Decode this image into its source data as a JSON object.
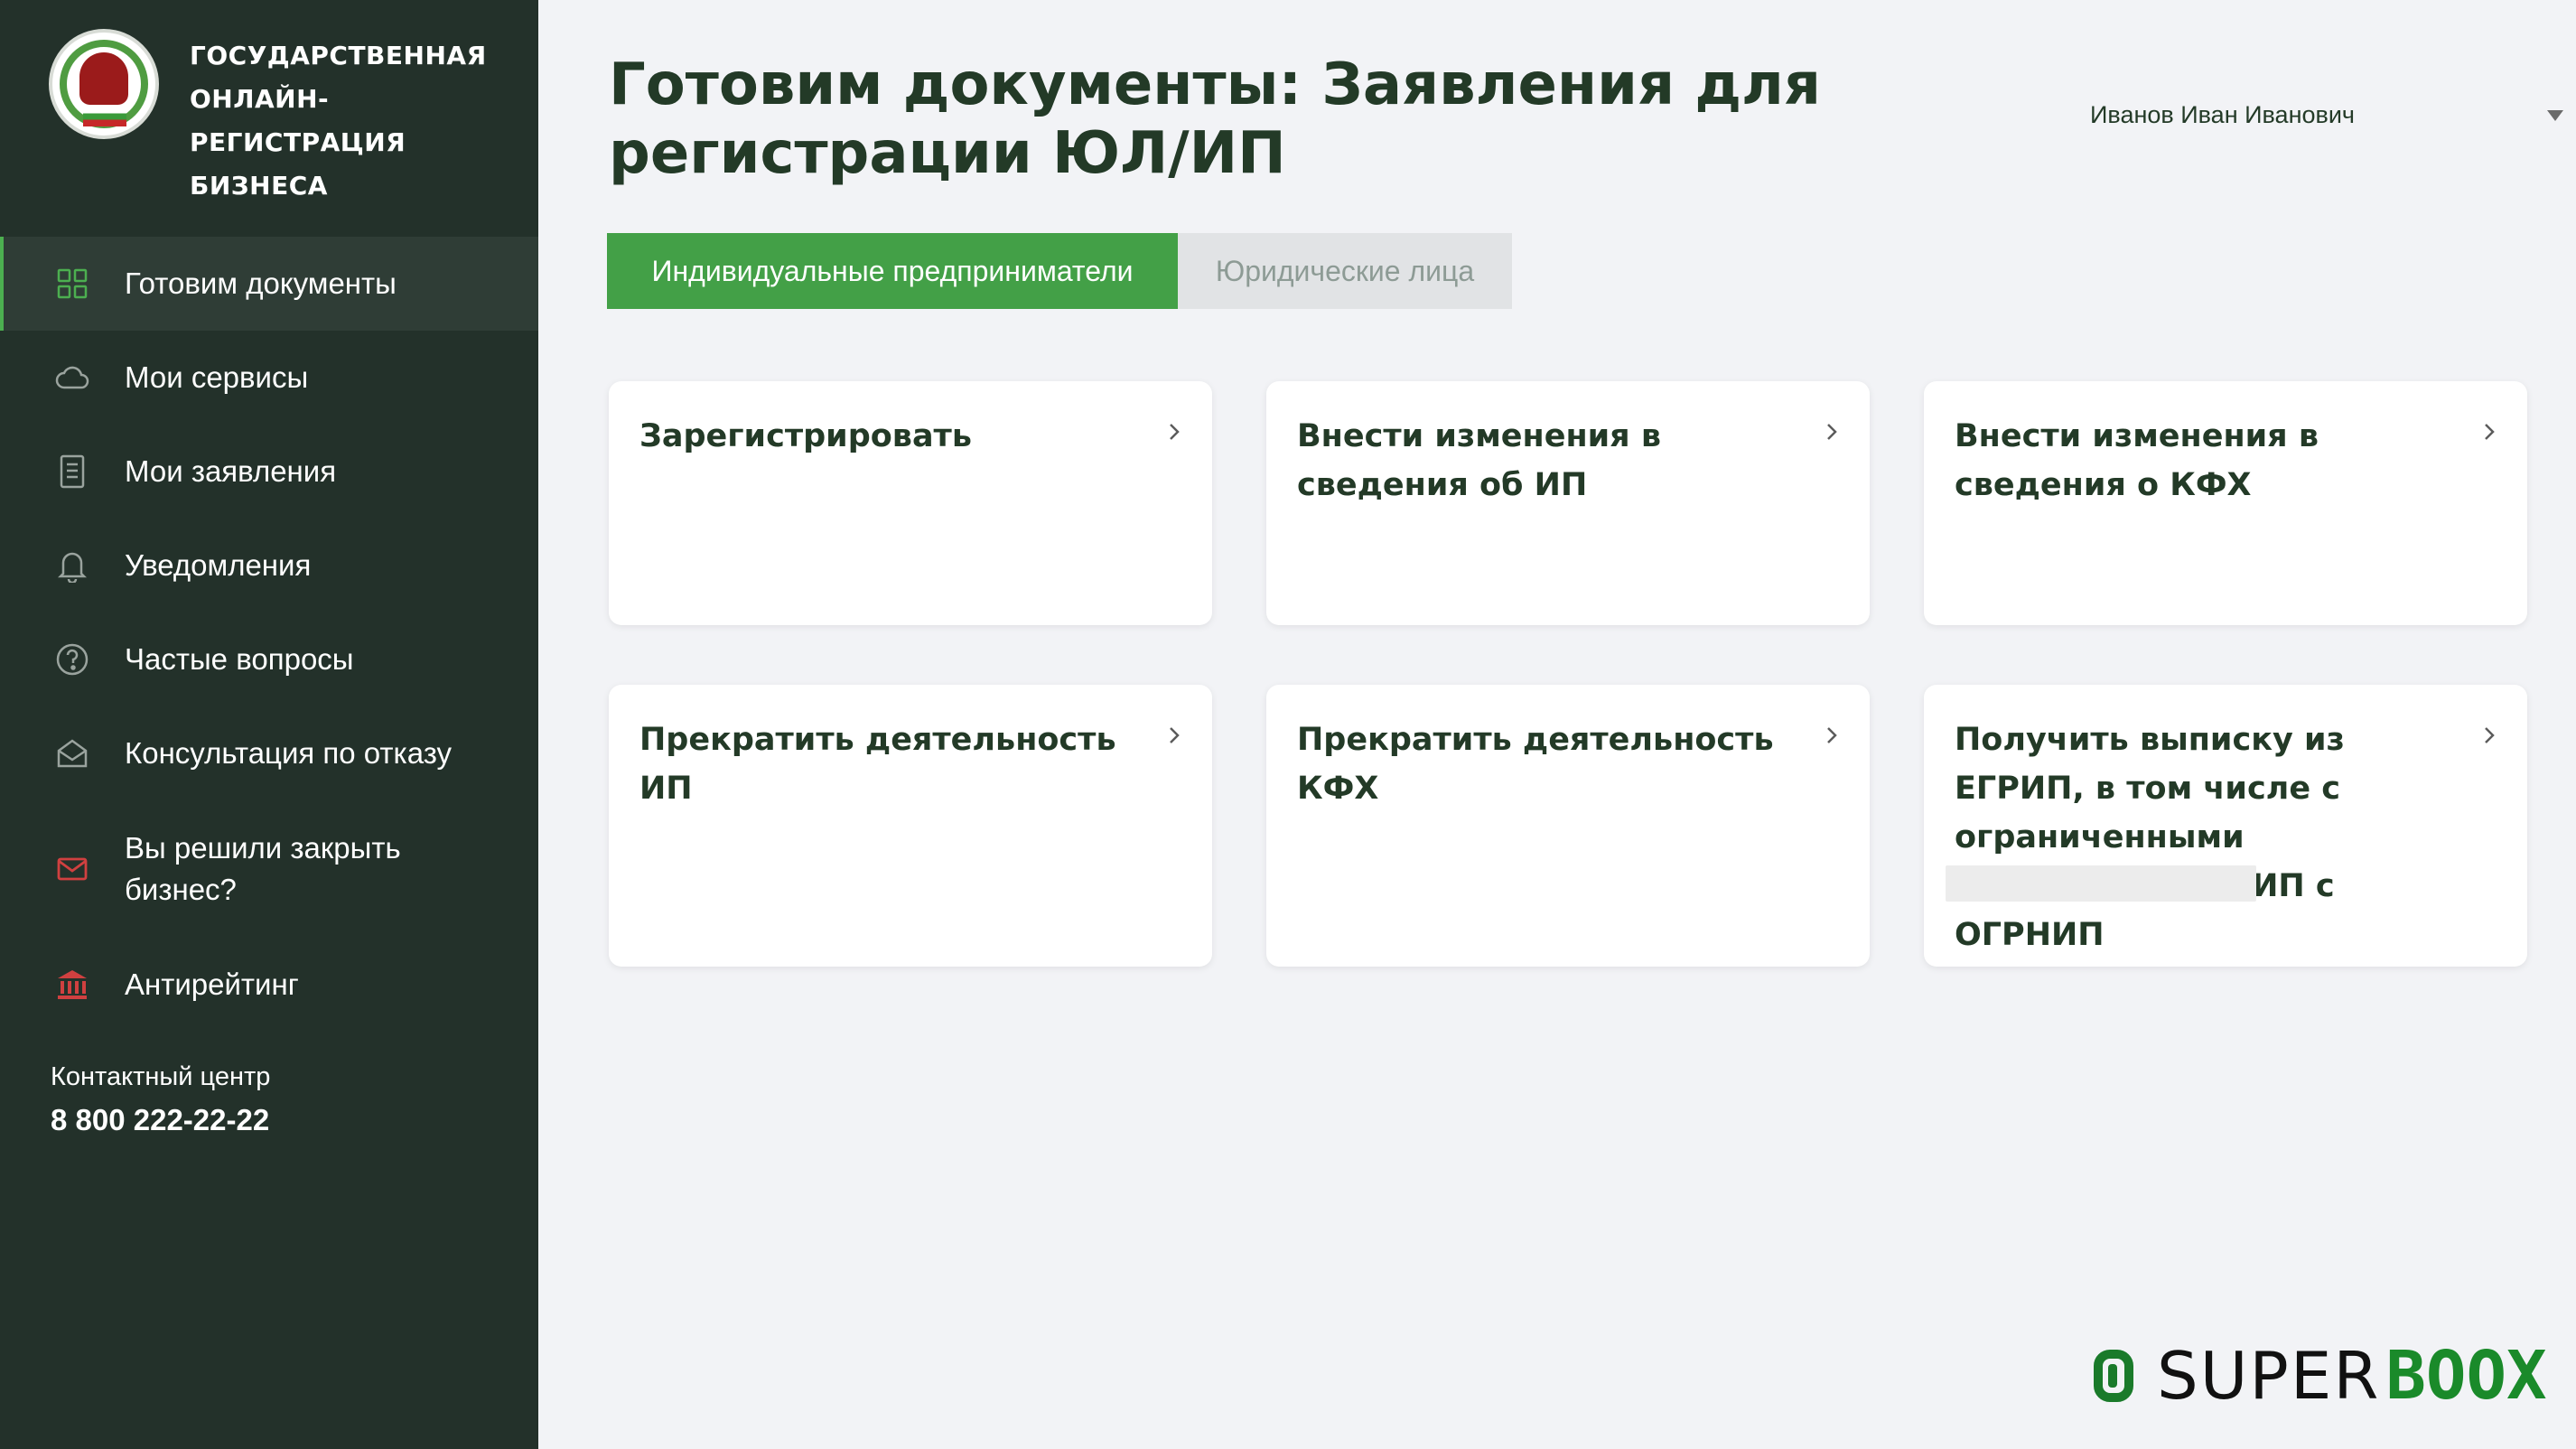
{
  "brand": {
    "text": "ГОСУДАРСТВЕННАЯ\nОНЛАЙН-РЕГИСТРАЦИЯ\nБИЗНЕСА",
    "emblem_icon": "fns-emblem-icon"
  },
  "sidebar": {
    "items": [
      {
        "label": "Готовим документы",
        "icon": "grid-icon",
        "active": true
      },
      {
        "label": "Мои сервисы",
        "icon": "cloud-icon"
      },
      {
        "label": "Мои заявления",
        "icon": "document-list-icon"
      },
      {
        "label": "Уведомления",
        "icon": "bell-icon"
      },
      {
        "label": "Частые вопросы",
        "icon": "question-icon"
      },
      {
        "label": "Консультация по отказу",
        "icon": "open-envelope-icon"
      },
      {
        "label": "Вы решили закрыть бизнес?",
        "icon": "envelope-icon"
      },
      {
        "label": "Антирейтинг",
        "icon": "bank-icon"
      }
    ],
    "contact": {
      "label": "Контактный центр",
      "phone": "8 800 222-22-22"
    }
  },
  "header": {
    "title": "Готовим документы: Заявления для регистрации ЮЛ/ИП",
    "user_name": "Иванов Иван Иванович"
  },
  "tabs": [
    {
      "label": "Индивидуальные предприниматели",
      "active": true
    },
    {
      "label": "Юридические лица",
      "active": false
    }
  ],
  "cards": [
    {
      "title": "Зарегистрировать"
    },
    {
      "title": "Внести изменения в сведения об ИП"
    },
    {
      "title": "Внести изменения в сведения о КФХ"
    },
    {
      "title": "Прекратить деятельность ИП"
    },
    {
      "title": "Прекратить деятельность КФХ"
    },
    {
      "title": "Получить выписку из ЕГРИП, в том числе с ограниченными сведениями, об ИП с ОГРНИП"
    }
  ],
  "watermark": {
    "super": "SUPER",
    "boox": "BOOX"
  },
  "colors": {
    "sidebar_bg": "#23312a",
    "accent_green": "#43a047",
    "title_text": "#233a27",
    "page_bg": "#f2f3f6",
    "alert_red": "#d04040"
  }
}
